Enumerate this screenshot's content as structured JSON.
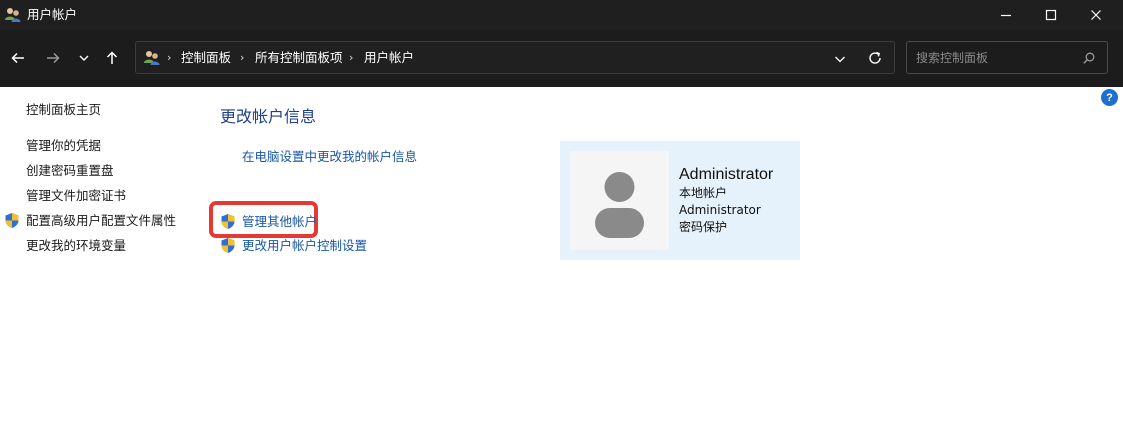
{
  "window": {
    "title": "用户帐户"
  },
  "nav": {
    "breadcrumbs": [
      "控制面板",
      "所有控制面板项",
      "用户帐户"
    ],
    "separator": "›",
    "search_placeholder": "搜索控制面板"
  },
  "help": {
    "label": "?"
  },
  "sidebar": {
    "items": [
      {
        "label": "控制面板主页",
        "shield": false
      },
      {
        "label": "管理你的凭据",
        "shield": false
      },
      {
        "label": "创建密码重置盘",
        "shield": false
      },
      {
        "label": "管理文件加密证书",
        "shield": false
      },
      {
        "label": "配置高级用户配置文件属性",
        "shield": true
      },
      {
        "label": "更改我的环境变量",
        "shield": false
      }
    ]
  },
  "main": {
    "heading": "更改帐户信息",
    "links": [
      {
        "label": "在电脑设置中更改我的帐户信息",
        "shield": false
      },
      {
        "label": "管理其他帐户",
        "shield": true,
        "highlighted": true
      },
      {
        "label": "更改用户帐户控制设置",
        "shield": true
      }
    ]
  },
  "account": {
    "name": "Administrator",
    "lines": [
      "本地帐户",
      "Administrator",
      "密码保护"
    ]
  },
  "colors": {
    "titlebar_bg": "#1f1f1f",
    "navbar_bg": "#1c1c1c",
    "link_blue": "#1756a9",
    "heading_blue": "#1e3f8a",
    "card_bg": "#e5f1fb",
    "highlight_red": "#e53935"
  },
  "icons": {
    "title": "users-icon",
    "back": "arrow-left-icon",
    "forward": "arrow-right-icon",
    "recent": "chevron-down-icon",
    "up": "arrow-up-icon",
    "address": "users-icon",
    "dropdown": "chevron-down-icon",
    "refresh": "refresh-icon",
    "search": "search-icon",
    "shield": "uac-shield-icon",
    "avatar": "user-avatar-icon",
    "help": "help-icon"
  }
}
